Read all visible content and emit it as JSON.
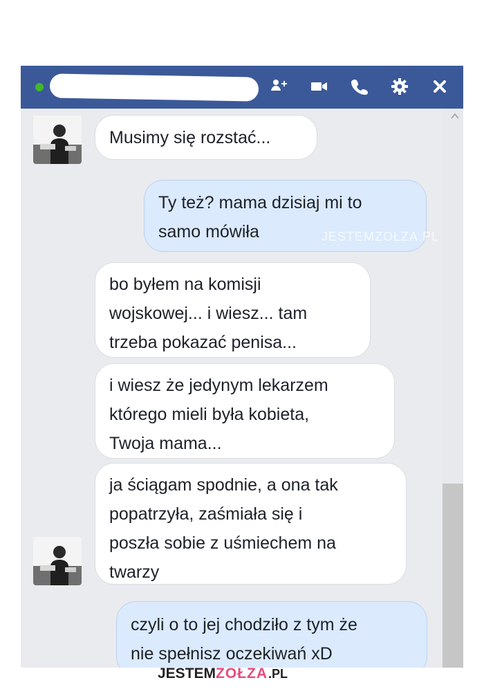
{
  "header": {
    "contact_name": "",
    "online_status_color": "#42b72a",
    "background_color": "#3b5998",
    "icons": [
      "add-person-icon",
      "video-call-icon",
      "phone-call-icon",
      "settings-gear-icon",
      "close-icon"
    ]
  },
  "messages": [
    {
      "direction": "incoming",
      "lines": [
        "Musimy się rozstać..."
      ],
      "avatar": true
    },
    {
      "direction": "outgoing",
      "lines": [
        "Ty też? mama dzisiaj mi to",
        "samo mówiła"
      ],
      "watermark": "JESTEMZOŁZA.PL"
    },
    {
      "direction": "incoming",
      "lines": [
        "bo byłem na komisji",
        "wojskowej... i wiesz... tam",
        "trzeba pokazać penisa..."
      ],
      "avatar": false
    },
    {
      "direction": "incoming",
      "lines": [
        "i wiesz że jedynym lekarzem",
        "którego mieli była kobieta,",
        "Twoja mama..."
      ],
      "avatar": false
    },
    {
      "direction": "incoming",
      "lines": [
        "ja ściągam spodnie, a ona tak",
        "popatrzyła, zaśmiała się i",
        "poszła sobie z uśmiechem na",
        "twarzy"
      ],
      "avatar": true
    },
    {
      "direction": "outgoing",
      "lines": [
        "czyli o to jej chodziło z tym że",
        "nie spełnisz oczekiwań xD"
      ]
    }
  ],
  "logo": {
    "part1": "JESTEM",
    "part2": "ZOŁZA",
    "part3": ".PL"
  },
  "colors": {
    "incoming_bubble": "#ffffff",
    "outgoing_bubble": "#dbeafd",
    "chat_background": "#e9ebee"
  }
}
